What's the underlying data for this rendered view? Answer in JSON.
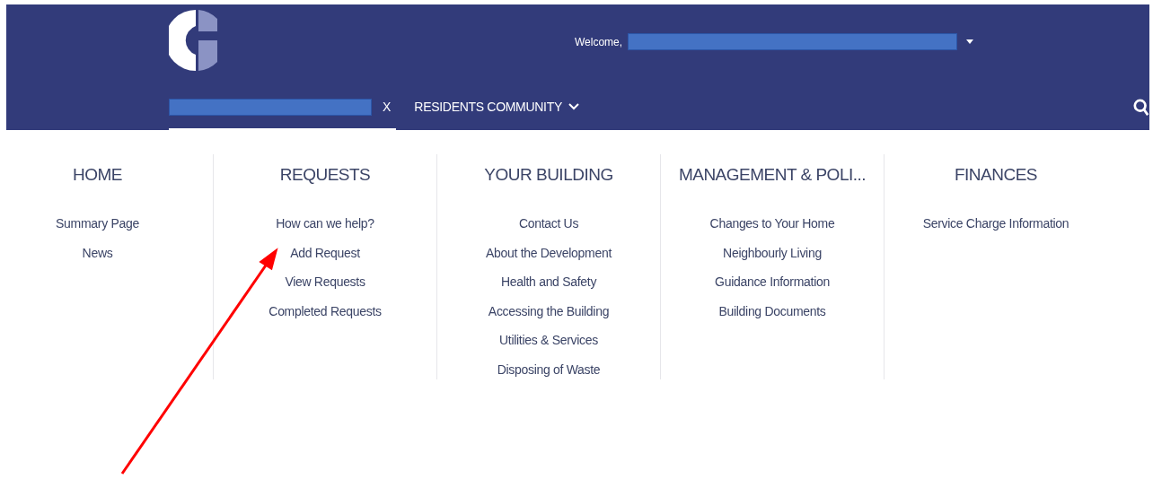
{
  "header": {
    "welcome": "Welcome,",
    "user_menu": {
      "kind": "redacted"
    }
  },
  "tabs": [
    {
      "kind": "redacted",
      "close": "X",
      "selected": true
    },
    {
      "kind": "dropdown",
      "label": "RESIDENTS COMMUNITY",
      "selected": false
    }
  ],
  "menu": [
    {
      "heading": "HOME",
      "items": [
        "Summary Page",
        "News"
      ]
    },
    {
      "heading": "REQUESTS",
      "items": [
        "How can we help?",
        "Add Request",
        "View Requests",
        "Completed Requests"
      ]
    },
    {
      "heading": "YOUR BUILDING",
      "items": [
        "Contact Us",
        "About the Development",
        "Health and Safety",
        "Accessing the Building",
        "Utilities & Services",
        "Disposing of Waste"
      ]
    },
    {
      "heading": "MANAGEMENT & POLI...",
      "items": [
        "Changes to Your Home",
        "Neighbourly Living",
        "Guidance Information",
        "Building Documents"
      ]
    },
    {
      "heading": "FINANCES",
      "items": [
        "Service Charge Information"
      ]
    }
  ]
}
